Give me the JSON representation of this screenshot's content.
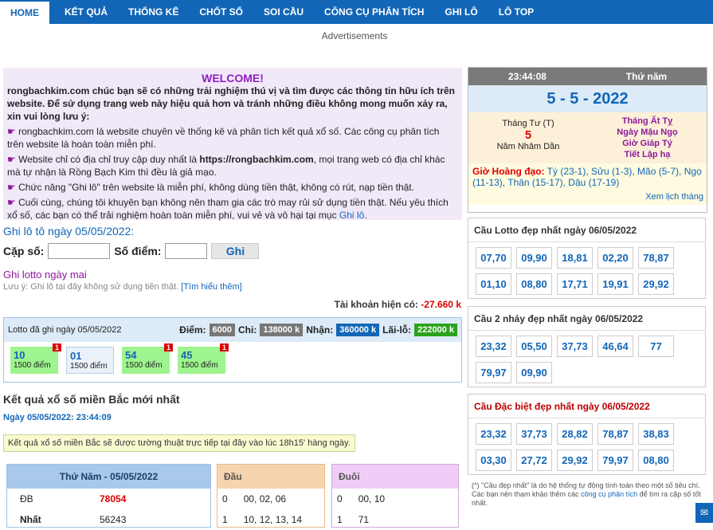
{
  "nav": [
    "HOME",
    "KẾT QUẢ",
    "THỐNG KÊ",
    "CHỐT SỐ",
    "SOI CẦU",
    "CÔNG CỤ PHÂN TÍCH",
    "GHI LÔ",
    "LÔ TOP"
  ],
  "ads": "Advertisements",
  "welcome": {
    "title": "WELCOME!",
    "intro": "rongbachkim.com chúc bạn sẽ có những trải nghiệm thú vị và tìm được các thông tin hữu ích trên website. Để sử dụng trang web này hiệu quả hơn và tránh những điều không mong muốn xảy ra, xin vui lòng lưu ý:",
    "b1": "rongbachkim.com là website chuyên về thống kê và phân tích kết quả xổ số. Các công cụ phân tích trên website là hoàn toàn miễn phí.",
    "b2_pre": "Website chỉ có địa chỉ truy cập duy nhất là",
    "b2_url": "https://rongbachkim.com",
    "b2_post": ", mọi trang web có địa chỉ khác mà tự nhận là Rồng Bạch Kim thì đều là giả mạo.",
    "b3": "Chức năng \"Ghi lô\" trên website là miễn phí, không dùng tiền thật, không có rút, nạp tiền thật.",
    "b4_pre": "Cuối cùng, chúng tôi khuyên bạn không nên tham gia các trò may rủi sử dụng tiền thật. Nếu yêu thích xổ số, các bạn có thể trải nghiệm hoàn toàn miễn phí, vui vẻ và vô hại tại mục",
    "b4_link": "Ghi lô",
    "bullet": "☛"
  },
  "ghilo": {
    "title": "Ghi lô tô ngày 05/05/2022:",
    "cap_so": "Cặp số:",
    "so_diem": "Số điểm:",
    "button": "Ghi",
    "lotto_link": "Ghi lotto ngày mai",
    "luuy": "Lưu ý: Ghi lô tại đây không sử dụng tiền thật.",
    "luuy_link": "[Tìm hiểu thêm]",
    "taikhoan_label": "Tài khoản hiện có:",
    "taikhoan_value": "-27.660 k"
  },
  "lotto": {
    "label": "Lotto đã ghi ngày 05/05/2022",
    "diem_label": "Điểm:",
    "diem": "6000",
    "chi_label": "Chi:",
    "chi": "138000 k",
    "nhan_label": "Nhận:",
    "nhan": "360000 k",
    "lailo_label": "Lãi-lỗ:",
    "lailo": "222000 k",
    "items": [
      {
        "num": "10",
        "pts": "1500 điểm",
        "badge": "1",
        "style": "g"
      },
      {
        "num": "01",
        "pts": "1500 điểm",
        "badge": "",
        "style": "b"
      },
      {
        "num": "54",
        "pts": "1500 điểm",
        "badge": "1",
        "style": "g"
      },
      {
        "num": "45",
        "pts": "1500 điểm",
        "badge": "1",
        "style": "g"
      }
    ]
  },
  "kq": {
    "title": "Kết quả xổ số miền Bắc mới nhất",
    "date": "Ngày 05/05/2022: 23:44:09",
    "note": "Kết quả xổ số miền Bắc sẽ được tường thuật trực tiếp tại đây vào lúc 18h15' hàng ngày.",
    "table_head": "Thứ Năm - 05/05/2022",
    "rows": [
      {
        "l": "ĐB",
        "r": "78054"
      },
      {
        "l": "Nhất",
        "r": "56243"
      }
    ],
    "dau_head": "Đầu",
    "dau_rows": [
      {
        "k": "0",
        "v": "00, 02, 06"
      },
      {
        "k": "1",
        "v": "10, 12, 13, 14"
      }
    ],
    "duoi_head": "Đuôi",
    "duoi_rows": [
      {
        "k": "0",
        "v": "00, 10"
      },
      {
        "k": "1",
        "v": "71"
      }
    ]
  },
  "cal": {
    "time": "23:44:08",
    "weekday": "Thứ năm",
    "date": "5 - 5 - 2022",
    "lunar_month": "Tháng Tư (T)",
    "lunar_day": "5",
    "lunar_year": "Năm Nhâm Dần",
    "r1": "Tháng Ất Tỵ",
    "r2": "Ngày Mậu Ngọ",
    "r3": "Giờ Giáp Tý",
    "r4": "Tiết Lập hạ",
    "hd_label": "Giờ Hoàng đạo:",
    "hd_text": "Tý (23-1), Sửu (1-3), Mão (5-7), Ngọ (11-13), Thân (15-17), Dậu (17-19)",
    "link": "Xem lịch tháng"
  },
  "cau1": {
    "title": "Cầu Lotto đẹp nhất ngày 06/05/2022",
    "cells": [
      "07,70",
      "09,90",
      "18,81",
      "02,20",
      "78,87",
      "01,10",
      "08,80",
      "17,71",
      "19,91",
      "29,92"
    ]
  },
  "cau2": {
    "title": "Cầu 2 nháy đẹp nhất ngày 06/05/2022",
    "cells": [
      "23,32",
      "05,50",
      "37,73",
      "46,64",
      "77",
      "79,97",
      "09,90"
    ]
  },
  "cau3": {
    "title": "Cầu Đặc biệt đẹp nhất ngày 06/05/2022",
    "cells": [
      "23,32",
      "37,73",
      "28,82",
      "78,87",
      "38,83",
      "03,30",
      "27,72",
      "29,92",
      "79,97",
      "08,80"
    ]
  },
  "foot": {
    "pre": "(*) \"Cầu đẹp nhất\" là do hệ thống tự động tính toán theo một số tiêu chí. Các bạn nên tham khảo thêm các",
    "link": "công cụ phân tích",
    "post": "để tìm ra cặp số tốt nhất."
  }
}
